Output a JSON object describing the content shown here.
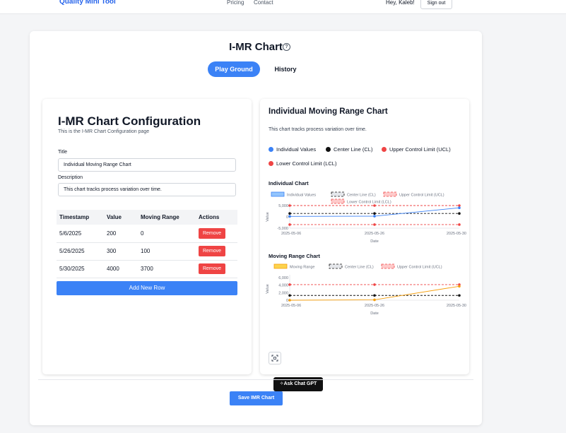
{
  "topbar": {
    "brand": "Quality Mini Tool",
    "nav": [
      "Pricing",
      "Contact"
    ],
    "greeting": "Hey, Kaleb!",
    "signout": "Sign out"
  },
  "page": {
    "title": "I-MR Chart",
    "tabs": {
      "active": "Play Ground",
      "other": "History"
    }
  },
  "config": {
    "title": "I-MR Chart Configuration",
    "subtitle": "This is the I-MR Chart Configuration page",
    "title_label": "Title",
    "title_value": "Individual Moving Range Chart",
    "desc_label": "Description",
    "desc_value": "This chart tracks process variation over time.",
    "table": {
      "headers": [
        "Timestamp",
        "Value",
        "Moving Range",
        "Actions"
      ],
      "rows": [
        [
          "5/6/2025",
          "200",
          "0"
        ],
        [
          "5/26/2025",
          "300",
          "100"
        ],
        [
          "5/30/2025",
          "4000",
          "3700"
        ]
      ],
      "remove_label": "Remove"
    },
    "add_row": "Add New Row"
  },
  "preview": {
    "title": "Individual Moving Range Chart",
    "description": "This chart tracks process variation over time.",
    "legend": [
      "Individual Values",
      "Center Line (CL)",
      "Upper Control Limit (UCL)",
      "Lower Control Limit (LCL)"
    ],
    "individual_title": "Individual Chart",
    "mr_title": "Moving Range Chart",
    "ask_gpt": "Ask Chat GPT"
  },
  "footer": {
    "save": "Save IMR Chart"
  },
  "colors": {
    "accent": "#3b82f6",
    "danger": "#ef4444",
    "mr_line": "#f59e0b"
  },
  "chart_data": [
    {
      "type": "line",
      "title": "Individual Chart",
      "xlabel": "Date",
      "ylabel": "Value",
      "categories": [
        "2025-05-06",
        "2025-05-26",
        "2025-05-30"
      ],
      "yticks": [
        "5,000",
        "0",
        "-5,000"
      ],
      "ylim": [
        -5000,
        5000
      ],
      "series": [
        {
          "name": "Individual Values",
          "values": [
            200,
            300,
            4000
          ]
        },
        {
          "name": "Center Line (CL)",
          "values": [
            1500,
            1500,
            1500
          ]
        },
        {
          "name": "Upper Control Limit (UCL)",
          "values": [
            6420,
            6420,
            6420
          ]
        },
        {
          "name": "Lower Control Limit (LCL)",
          "values": [
            -3420,
            -3420,
            -3420
          ]
        }
      ]
    },
    {
      "type": "line",
      "title": "Moving Range Chart",
      "xlabel": "Date",
      "ylabel": "Value",
      "categories": [
        "2025-05-06",
        "2025-05-26",
        "2025-05-30"
      ],
      "yticks": [
        "6,000",
        "4,000",
        "2,000",
        "0"
      ],
      "ylim": [
        0,
        6000
      ],
      "series": [
        {
          "name": "Moving Range",
          "values": [
            0,
            100,
            3700
          ]
        },
        {
          "name": "Center Line (CL)",
          "values": [
            1267,
            1267,
            1267
          ]
        },
        {
          "name": "Upper Control Limit (UCL)",
          "values": [
            4138,
            4138,
            4138
          ]
        }
      ]
    }
  ]
}
